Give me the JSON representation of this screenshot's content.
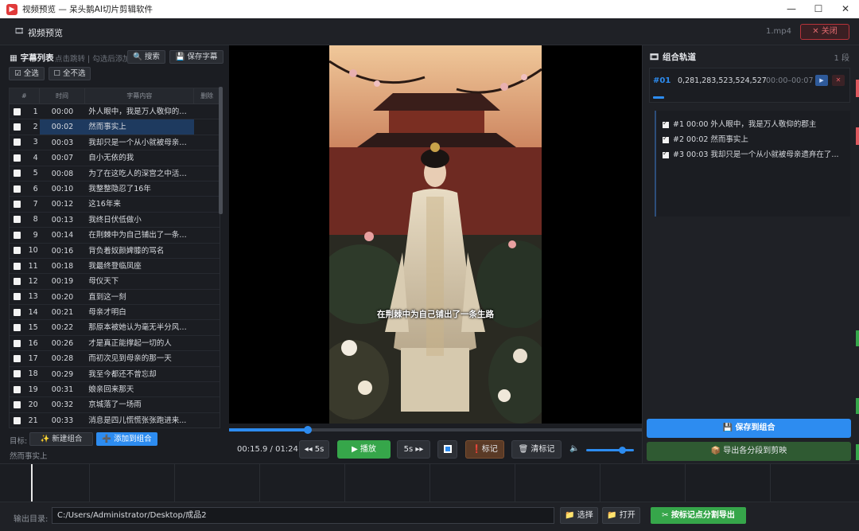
{
  "window": {
    "title": "视频预览 — 呆头鹅AI切片剪辑软件",
    "minimize": "—",
    "maximize": "☐",
    "close": "✕"
  },
  "header": {
    "title": "视频预览",
    "file_name": "1.mp4",
    "close_label": "✕ 关闭"
  },
  "subtitle_list": {
    "title": "字幕列表",
    "hint": "点击跳转 | 勾选后添加",
    "search_label": "🔍 搜索",
    "save_label": "💾 保存字幕",
    "select_all_label": "☑ 全选",
    "select_none_label": "☐ 全不选",
    "columns": [
      "#",
      "时间",
      "字幕内容",
      "删除"
    ],
    "rows": [
      {
        "num": "1",
        "time": "00:00",
        "text": "外人眼中，我是万人敬仰的郡主"
      },
      {
        "num": "2",
        "time": "00:02",
        "text": "然而事实上"
      },
      {
        "num": "3",
        "time": "00:03",
        "text": "我却只是一个从小就被母亲遗弃在了..."
      },
      {
        "num": "4",
        "time": "00:07",
        "text": "自小无依的我"
      },
      {
        "num": "5",
        "time": "00:08",
        "text": "为了在这吃人的深宫之中活下去"
      },
      {
        "num": "6",
        "time": "00:10",
        "text": "我整整隐忍了16年"
      },
      {
        "num": "7",
        "time": "00:12",
        "text": "这16年来"
      },
      {
        "num": "8",
        "time": "00:13",
        "text": "我终日伏低做小"
      },
      {
        "num": "9",
        "time": "00:14",
        "text": "在荆棘中为自己铺出了一条生路"
      },
      {
        "num": "10",
        "time": "00:16",
        "text": "背负着奴颜婢膝的骂名"
      },
      {
        "num": "11",
        "time": "00:18",
        "text": "我最终登临凤座"
      },
      {
        "num": "12",
        "time": "00:19",
        "text": "母仪天下"
      },
      {
        "num": "13",
        "time": "00:20",
        "text": "直到这一刻"
      },
      {
        "num": "14",
        "time": "00:21",
        "text": "母亲才明白"
      },
      {
        "num": "15",
        "time": "00:22",
        "text": "那原本被她认为毫无半分风骨的女儿"
      },
      {
        "num": "16",
        "time": "00:26",
        "text": "才是真正能撑起一切的人"
      },
      {
        "num": "17",
        "time": "00:28",
        "text": "而初次见到母亲的那一天"
      },
      {
        "num": "18",
        "time": "00:29",
        "text": "我至今都还不曾忘却"
      },
      {
        "num": "19",
        "time": "00:31",
        "text": "娘亲回来那天"
      },
      {
        "num": "20",
        "time": "00:32",
        "text": "京城落了一场雨"
      },
      {
        "num": "21",
        "time": "00:33",
        "text": "消息是四儿慌慌张张跑进来..."
      }
    ],
    "selected_index": 1,
    "target_label": "目标:",
    "new_group_label": "✨ 新建组合",
    "add_to_group_label": "➕ 添加到组合",
    "status_text": "然而事实上"
  },
  "player": {
    "subtitle_overlay": "在荆棘中为自己铺出了一条生路",
    "time_readout": "00:15.9 / 01:24",
    "progress": 0.19,
    "volume": 0.75,
    "back_label": "◂◂ 5s",
    "play_label": "▶ 播放",
    "forward_label": "5s ▸▸",
    "mark_label": "❗标记",
    "clear_marks_label": "🗑 清标记",
    "volume_icon": "🔈"
  },
  "group_track": {
    "title": "组合轨道",
    "count": "1 段",
    "segment": {
      "id": "#01",
      "indices": "0,281,283,523,524,527",
      "range": "00:00–00:07",
      "play": "▶",
      "delete": "✕"
    },
    "items": [
      {
        "label": "#1  00:00  外人眼中，我是万人敬仰的郡主"
      },
      {
        "label": "#2  00:02  然而事实上"
      },
      {
        "label": "#3  00:03  我却只是一个从小就被母亲遗弃在了..."
      }
    ],
    "save_group_label": "💾 保存到组合",
    "export_segments_label": "📦 导出各分段到剪映"
  },
  "footer": {
    "output_label": "输出目录:",
    "output_path": "C:/Users/Administrator/Desktop/成品2",
    "choose_label": "📁 选择",
    "open_label": "📁 打开",
    "export_by_marks_label": "✂ 按标记点分割导出"
  },
  "colors": {
    "accent": "#2d8cf0",
    "success": "#36a64a",
    "danger": "#e05a60",
    "background": "#1b1d22"
  }
}
